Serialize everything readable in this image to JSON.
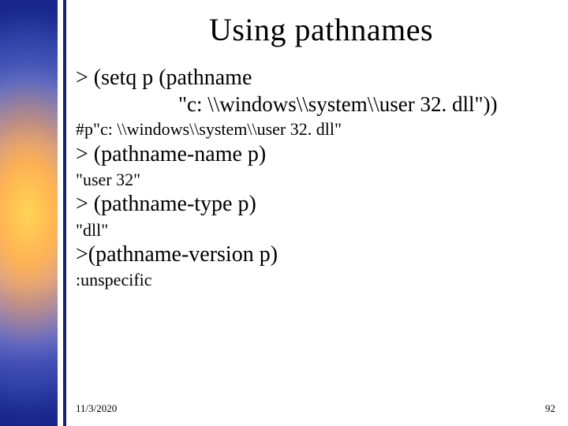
{
  "slide": {
    "title": "Using pathnames",
    "lines": [
      {
        "cls": "l-large",
        "text": "> (setq p (pathname"
      },
      {
        "cls": "l-large indent",
        "text": "\"c: \\\\windows\\\\system\\\\user 32. dll\"))"
      },
      {
        "cls": "l-med",
        "text": "#p\"c: \\\\windows\\\\system\\\\user 32. dll\""
      },
      {
        "cls": "l-large",
        "text": "> (pathname-name p)"
      },
      {
        "cls": "l-med",
        "text": "\"user 32\""
      },
      {
        "cls": "l-large",
        "text": "> (pathname-type p)"
      },
      {
        "cls": "l-med",
        "text": "\"dll\""
      },
      {
        "cls": "l-large",
        "text": ">(pathname-version p)"
      },
      {
        "cls": "l-med",
        "text": ":unspecific"
      }
    ],
    "footer": {
      "date": "11/3/2020",
      "page": "92"
    }
  }
}
